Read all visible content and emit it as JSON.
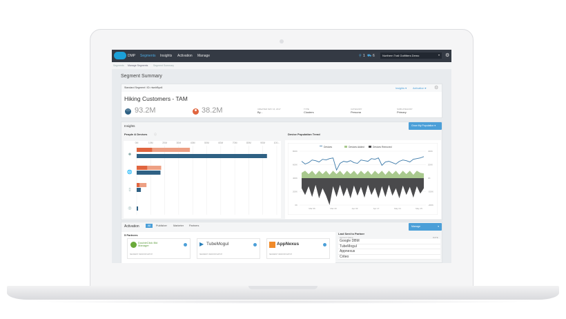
{
  "nav": {
    "brand": "DMP",
    "items": [
      "Segments",
      "Insights",
      "Activation",
      "Manage"
    ],
    "active": "Segments",
    "notif_count": "1",
    "cart_count": "6",
    "org": "Northern Trail Outfitters Demo"
  },
  "breadcrumb": [
    "Segments",
    "Manage Segments",
    "Segment Summary"
  ],
  "page_title": "Segment Summary",
  "segment": {
    "type_id": "Standard Segment / ID: rtwchByo6",
    "insights_menu": "Insights ▾",
    "activation_menu": "Activation ▾",
    "name": "Hiking Customers - TAM",
    "devices": "93.2M",
    "people": "38.2M",
    "meta": [
      {
        "label": "CREATED MAY 16, 2017",
        "value": "By -"
      },
      {
        "label": "TYPE",
        "value": "Clusters"
      },
      {
        "label": "CATEGORY",
        "value": "Persona"
      },
      {
        "label": "SUBCATEGORY",
        "value": "Primary"
      }
    ]
  },
  "insights": {
    "title": "Insights",
    "grow_button": "Grow My Population ▾",
    "people_devices_title": "People & Devices",
    "trend_title": "Device Population Trend"
  },
  "colors": {
    "people_dark": "#e0653f",
    "people_light": "#eda084",
    "devices": "#2f6184",
    "added": "#a9c98e",
    "removed": "#4a4a4c",
    "line": "#3a78a8",
    "accent": "#4b9fd8"
  },
  "chart_data": [
    {
      "type": "bar",
      "xticks": [
        "0M",
        "10M",
        "20M",
        "30M",
        "40M",
        "50M",
        "60M",
        "70M",
        "80M",
        "90M",
        "100..."
      ],
      "xlim": [
        0,
        100
      ],
      "unit": "M",
      "categories": [
        "all",
        "desktop",
        "mobile",
        "other"
      ],
      "category_icons": [
        "people-device-icon",
        "globe-icon",
        "mobile-icon",
        "compass-icon"
      ],
      "series": [
        {
          "values": [
            11,
            7.5,
            2,
            0
          ]
        },
        {
          "values": [
            38,
            17.5,
            7,
            0
          ]
        },
        {
          "values": [
            93,
            17,
            3,
            1
          ]
        }
      ]
    },
    {
      "type": "line",
      "legend": [
        "Devices",
        "Devices Added",
        "Devices Removed"
      ],
      "legend_position": "top",
      "yticks_left": [
        "800K",
        "600K",
        "400K",
        "200K",
        "0K"
      ],
      "ylim_left": [
        0,
        800
      ],
      "yticks_right": [
        "400K",
        "200K",
        "0K",
        "-200K",
        "-400K"
      ],
      "ylim_right": [
        -400,
        400
      ],
      "xticks": [
        "Mar 06",
        "Mar 20",
        "Apr 03",
        "Apr 17",
        "May 01",
        "May 15"
      ],
      "devices": [
        650,
        610,
        630,
        670,
        660,
        640,
        680,
        670,
        690,
        700,
        520,
        620,
        650,
        640,
        660,
        630,
        620,
        670,
        660,
        650,
        690,
        680,
        700,
        590,
        640,
        650,
        630,
        610,
        650,
        670,
        660,
        640,
        680,
        690,
        700,
        720
      ],
      "added": [
        80,
        110,
        60,
        110,
        50,
        110,
        60,
        110,
        50,
        110,
        60,
        110,
        50,
        110,
        60,
        110,
        50,
        110,
        60,
        110,
        50,
        110,
        60,
        110,
        50,
        110,
        60,
        110,
        50,
        110,
        60,
        110,
        50,
        110,
        80,
        70
      ],
      "removed": [
        -150,
        -250,
        -120,
        -280,
        -100,
        -300,
        -150,
        -260,
        -400,
        -120,
        -280,
        -100,
        -270,
        -140,
        -300,
        -110,
        -260,
        -130,
        -290,
        -100,
        -250,
        -140,
        -300,
        -120,
        -280,
        -100,
        -260,
        -150,
        -300,
        -110,
        -250,
        -130,
        -290,
        -120,
        -230,
        -150
      ]
    }
  ],
  "activation": {
    "title": "Activation",
    "tabs": [
      "All",
      "Publisher",
      "Marketer",
      "Partners"
    ],
    "manage_button": "Manage",
    "partners_count": "5 Partners",
    "partners": [
      {
        "name": "DoubleClick Bid Manager",
        "match": "SEGMENT VENDOR MATCH"
      },
      {
        "name": "TubeMogul",
        "match": "SEGMENT VENDOR MATCH"
      },
      {
        "name": "AppNexus",
        "match": "SEGMENT VENDOR MATCH"
      }
    ],
    "last_sent_title": "Last Sent to Partner",
    "col_account": "Account Name",
    "col_date": "DATE",
    "rows": [
      "Google DBM",
      "TubeMogul",
      "Appnexus",
      "Criteo"
    ]
  }
}
